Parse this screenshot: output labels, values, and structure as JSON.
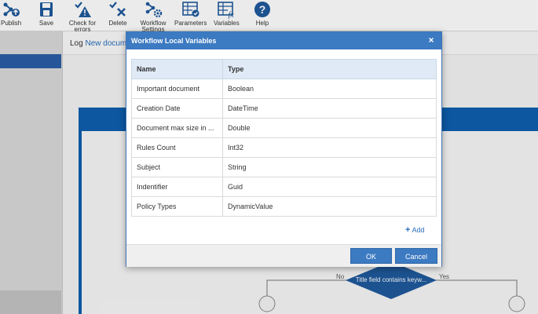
{
  "toolbar": {
    "items": [
      {
        "label": "Publish",
        "icon": "publish-icon"
      },
      {
        "label": "Save",
        "icon": "save-icon"
      },
      {
        "label": "Check for errors",
        "icon": "check-errors-icon"
      },
      {
        "label": "Delete",
        "icon": "delete-icon"
      },
      {
        "label": "Workflow Settings",
        "icon": "workflow-settings-icon"
      },
      {
        "label": "Parameters",
        "icon": "parameters-icon"
      },
      {
        "label": "Variables",
        "icon": "variables-icon"
      },
      {
        "label": "Help",
        "icon": "help-icon"
      }
    ]
  },
  "breadcrumb": {
    "root": "Log",
    "current": "New docume"
  },
  "flow": {
    "decision_label": "Title field contains keyw...",
    "no_label": "No",
    "yes_label": "Yes"
  },
  "dialog": {
    "title": "Workflow Local Variables",
    "close_glyph": "×",
    "columns": [
      "Name",
      "Type"
    ],
    "rows": [
      {
        "name": "Important document",
        "type": "Boolean"
      },
      {
        "name": "Creation Date",
        "type": "DateTime"
      },
      {
        "name": "Document max size in ...",
        "type": "Double"
      },
      {
        "name": "Rules Count",
        "type": "Int32"
      },
      {
        "name": "Subject",
        "type": "String"
      },
      {
        "name": "Indentifier",
        "type": "Guid"
      },
      {
        "name": "Policy Types",
        "type": "DynamicValue"
      }
    ],
    "add_label": "Add",
    "ok_label": "OK",
    "cancel_label": "Cancel"
  },
  "colors": {
    "accent": "#3c7ac2",
    "toolbar_icon": "#1f5a9c",
    "frame": "#0e5fae",
    "decision": "#1f5a9c"
  }
}
